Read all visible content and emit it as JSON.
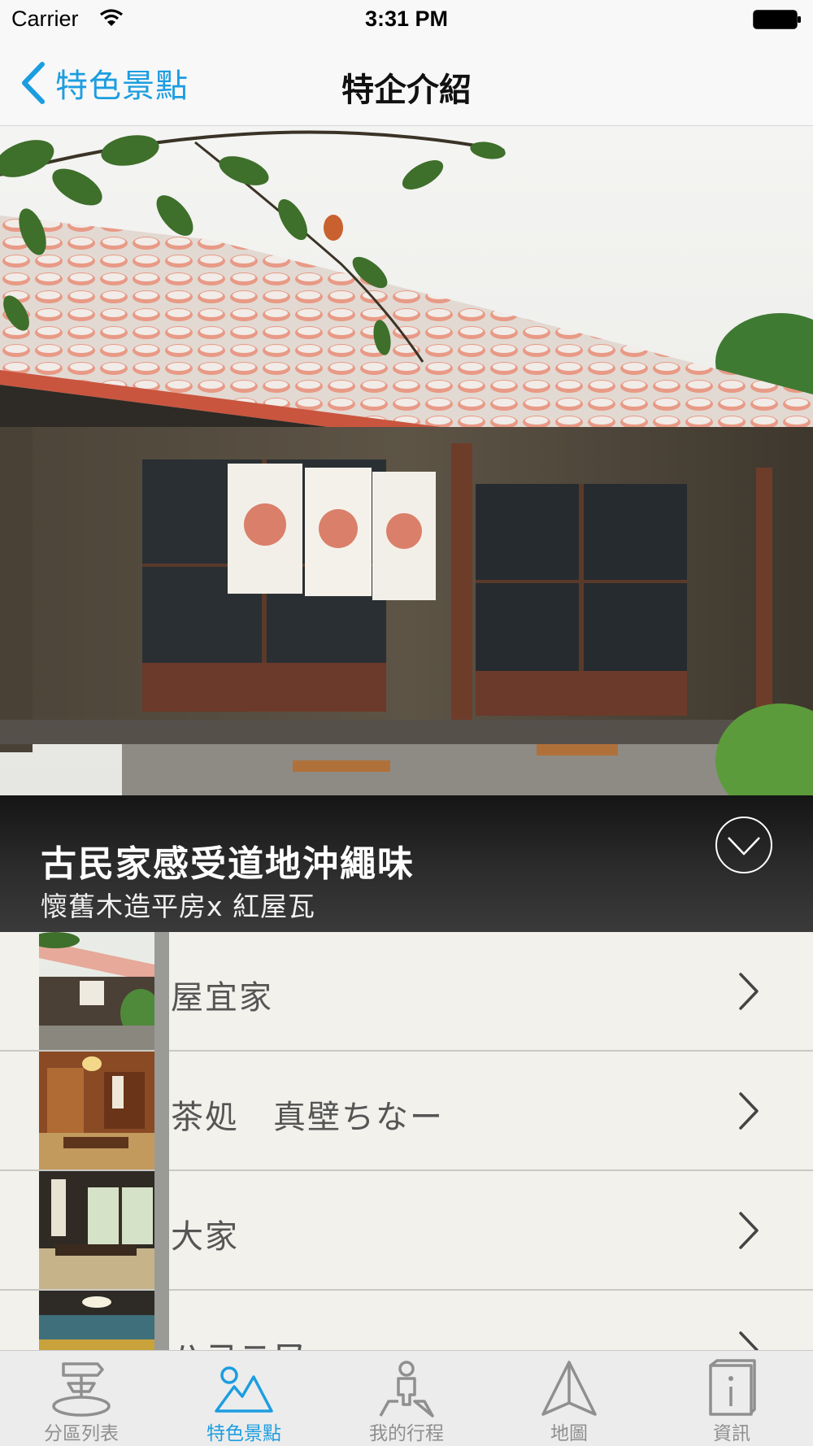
{
  "status_bar": {
    "carrier": "Carrier",
    "time": "3:31 PM"
  },
  "nav": {
    "back_label": "特色景點",
    "title": "特企介紹"
  },
  "feature": {
    "title": "古民家感受道地沖繩味",
    "subtitle": "懷舊木造平房x 紅屋瓦"
  },
  "list": {
    "items": [
      {
        "label": "屋宜家"
      },
      {
        "label": "茶処　真壁ちなー"
      },
      {
        "label": "大家"
      },
      {
        "label": "ハコニワ"
      }
    ]
  },
  "tabs": [
    {
      "label": "分區列表",
      "icon": "signpost-icon"
    },
    {
      "label": "特色景點",
      "icon": "mountain-icon"
    },
    {
      "label": "我的行程",
      "icon": "traveler-icon"
    },
    {
      "label": "地圖",
      "icon": "compass-arrow-icon"
    },
    {
      "label": "資訊",
      "icon": "info-book-icon"
    }
  ],
  "colors": {
    "accent": "#1c9de0",
    "tab_inactive": "#8f8f8f",
    "list_bg": "#f2f1ec"
  }
}
